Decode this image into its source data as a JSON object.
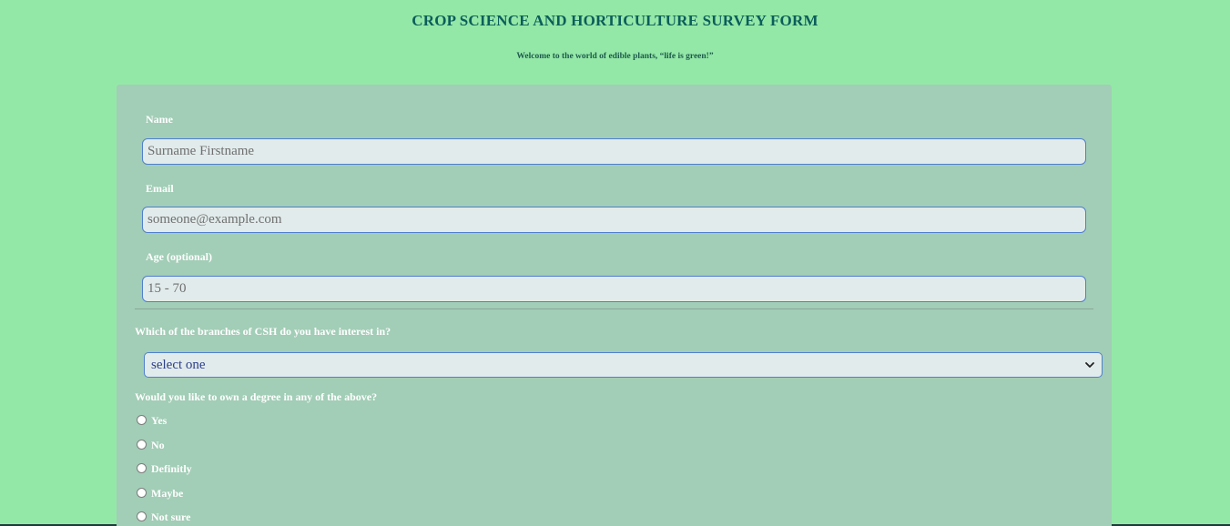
{
  "header": {
    "title": "CROP SCIENCE AND HORTICULTURE SURVEY FORM",
    "subtitle": "Welcome to the world of edible plants, “life is green!”"
  },
  "form": {
    "name": {
      "label": "Name",
      "placeholder": "Surname Firstname",
      "value": ""
    },
    "email": {
      "label": "Email",
      "placeholder": "someone@example.com",
      "value": ""
    },
    "age": {
      "label": "Age (optional)",
      "placeholder": "15 - 70",
      "value": ""
    },
    "branch": {
      "question": "Which of the branches of CSH do you have interest in?",
      "selected": "select one",
      "icon": "chevron-down-icon"
    },
    "degree": {
      "question": "Would you like to own a degree in any of the above?",
      "options": [
        {
          "label": "Yes",
          "checked": false
        },
        {
          "label": "No",
          "checked": false
        },
        {
          "label": "Definitly",
          "checked": false
        },
        {
          "label": "Maybe",
          "checked": false
        },
        {
          "label": "Not sure",
          "checked": false
        }
      ]
    }
  },
  "colors": {
    "page_background": "#94e8a7",
    "card_background": "#a2cdb6",
    "title": "#0c5e5a",
    "input_border": "#4f7fd0",
    "input_background": "#e2ebeb",
    "label": "#ffffff"
  }
}
